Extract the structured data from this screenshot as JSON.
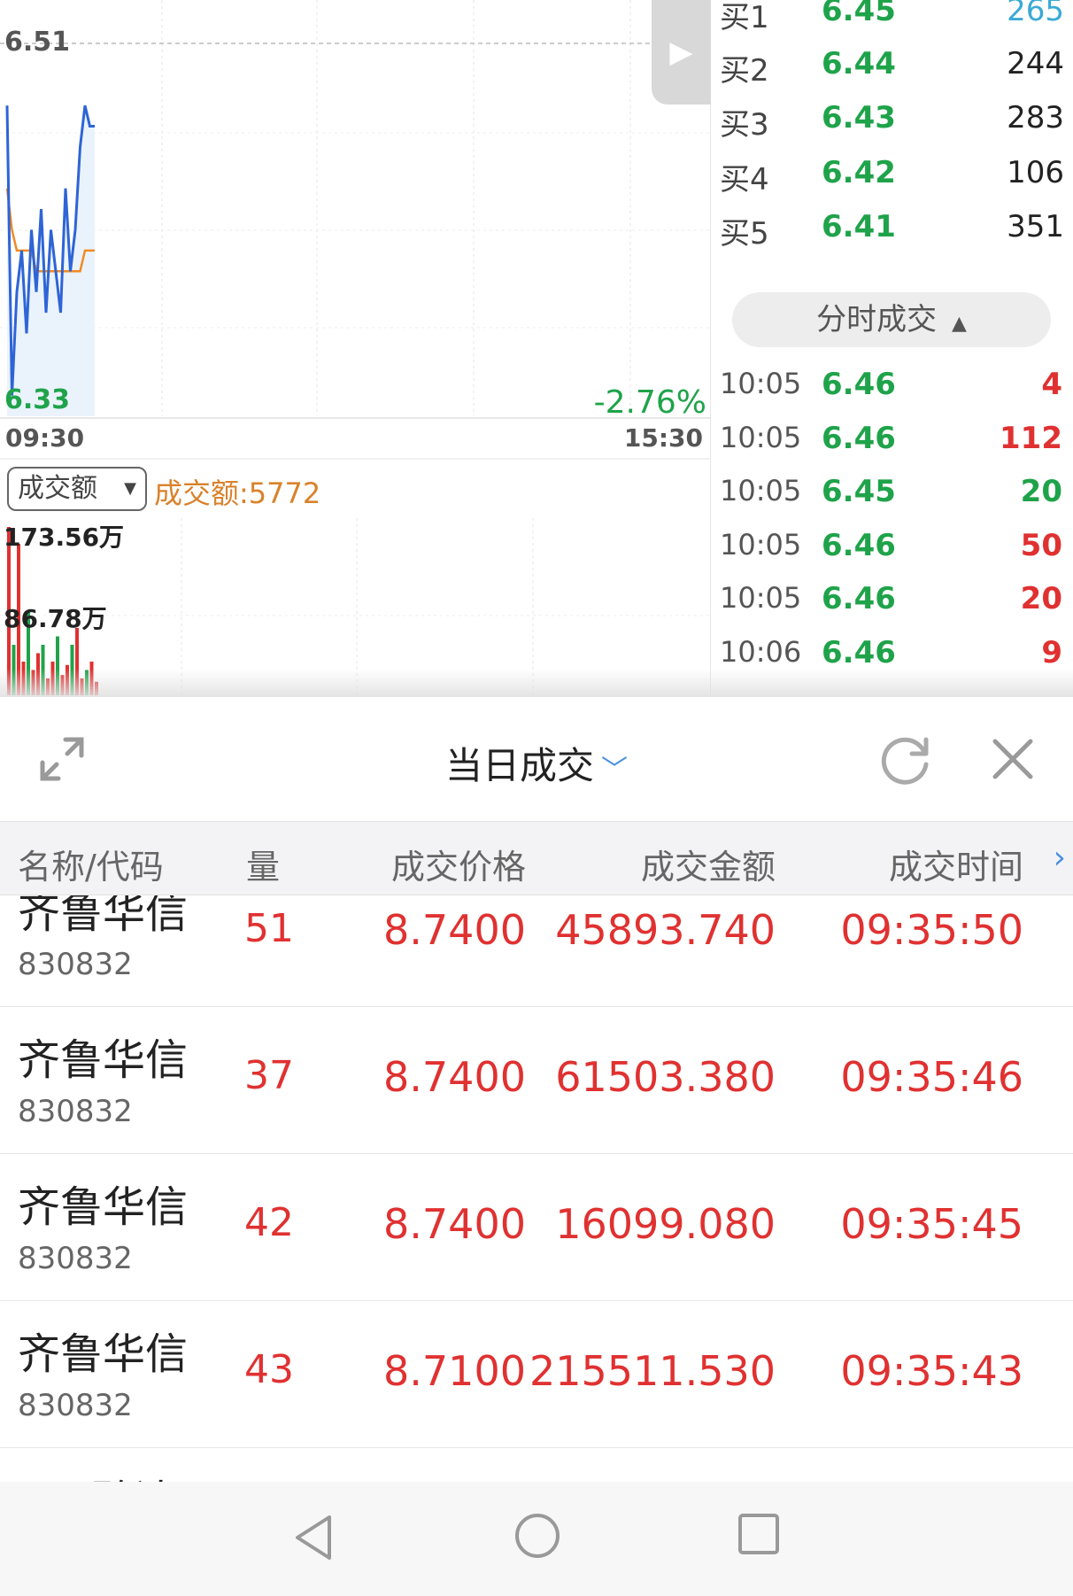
{
  "chart": {
    "price_max": "6.51",
    "price_min": "6.33",
    "change_pct": "-2.76%",
    "time_start": "09:30",
    "time_end": "15:30",
    "volume_selector": "成交额",
    "volume_amount": "成交额:5772",
    "volume_max": "173.56万",
    "volume_mid": "86.78万"
  },
  "chart_data": {
    "type": "line",
    "series": [
      {
        "values": [
          6.48,
          6.34,
          6.39,
          6.41,
          6.37,
          6.42,
          6.39,
          6.43,
          6.38,
          6.42,
          6.4,
          6.38,
          6.44,
          6.4,
          6.42,
          6.46,
          6.48,
          6.47,
          6.47
        ]
      },
      {
        "values": [
          6.44,
          6.42,
          6.41,
          6.41,
          6.41,
          6.41,
          6.4,
          6.4,
          6.4,
          6.4,
          6.4,
          6.4,
          6.4,
          6.4,
          6.4,
          6.4,
          6.41,
          6.41,
          6.41
        ]
      }
    ],
    "ylim": [
      6.33,
      6.51
    ],
    "volume_series": [
      1.0,
      0.3,
      0.9,
      0.2,
      0.5,
      0.15,
      0.25,
      0.3,
      0.1,
      0.2,
      0.35,
      0.12,
      0.18,
      0.3,
      0.4,
      0.1,
      0.15,
      0.2,
      0.08
    ]
  },
  "order_book": {
    "bids": [
      {
        "name": "买1",
        "price": "6.45",
        "volume": "265"
      },
      {
        "name": "买2",
        "price": "6.44",
        "volume": "244"
      },
      {
        "name": "买3",
        "price": "6.43",
        "volume": "283"
      },
      {
        "name": "买4",
        "price": "6.42",
        "volume": "106"
      },
      {
        "name": "买5",
        "price": "6.41",
        "volume": "351"
      }
    ],
    "ticks_header": "分时成交",
    "ticks": [
      {
        "time": "10:05",
        "price": "6.46",
        "volume": "4",
        "dir": "up"
      },
      {
        "time": "10:05",
        "price": "6.46",
        "volume": "112",
        "dir": "up"
      },
      {
        "time": "10:05",
        "price": "6.45",
        "volume": "20",
        "dir": "down"
      },
      {
        "time": "10:05",
        "price": "6.46",
        "volume": "50",
        "dir": "up"
      },
      {
        "time": "10:05",
        "price": "6.46",
        "volume": "20",
        "dir": "up"
      },
      {
        "time": "10:06",
        "price": "6.46",
        "volume": "9",
        "dir": "up"
      }
    ]
  },
  "sheet": {
    "title": "当日成交",
    "columns": {
      "name": "名称/代码",
      "qty": "量",
      "price": "成交价格",
      "amount": "成交金额",
      "time": "成交时间"
    },
    "rows": [
      {
        "name": "齐鲁华信",
        "code": "830832",
        "qty": "51",
        "price": "8.7400",
        "amount": "45893.740",
        "time": "09:35:50"
      },
      {
        "name": "齐鲁华信",
        "code": "830832",
        "qty": "37",
        "price": "8.7400",
        "amount": "61503.380",
        "time": "09:35:46"
      },
      {
        "name": "齐鲁华信",
        "code": "830832",
        "qty": "42",
        "price": "8.7400",
        "amount": "16099.080",
        "time": "09:35:45"
      },
      {
        "name": "齐鲁华信",
        "code": "830832",
        "qty": "43",
        "price": "8.7100",
        "amount": "215511.530",
        "time": "09:35:43"
      },
      {
        "name": "*ST聆达",
        "code": "",
        "qty": "",
        "price": "",
        "amount": "",
        "time": ""
      }
    ]
  },
  "colors": {
    "up": "#e03131",
    "down": "#1fa34a",
    "accent": "#4a90e2"
  }
}
